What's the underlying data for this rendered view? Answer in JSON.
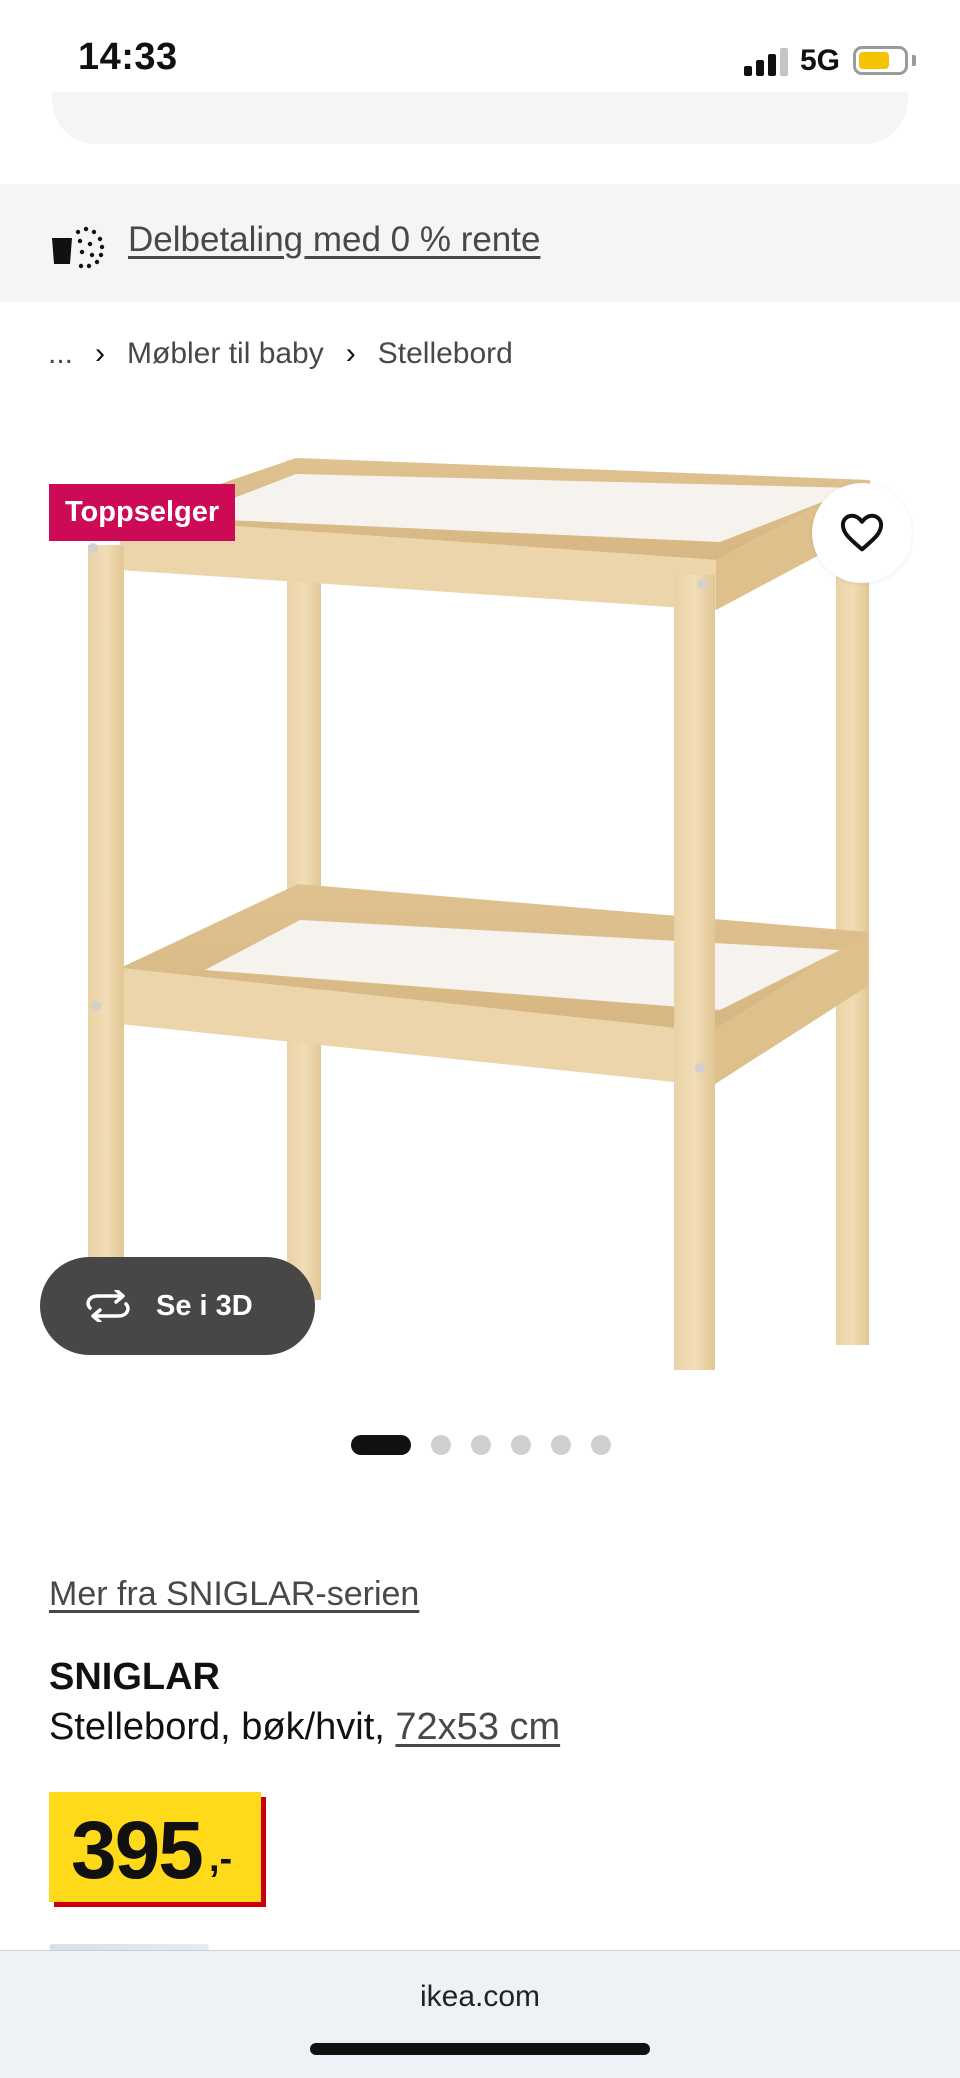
{
  "status_bar": {
    "time": "14:33",
    "network": "5G",
    "battery_level": 0.7,
    "battery_color": "#f5c400"
  },
  "installment_banner": {
    "icon": "installment-payment-icon",
    "link_text": "Delbetaling med 0 % rente"
  },
  "breadcrumb": {
    "items": [
      "...",
      "Møbler til baby",
      "Stellebord"
    ],
    "separator_icon": "chevron-right-icon"
  },
  "gallery": {
    "badge": "Toppselger",
    "badge_color": "#cc0a56",
    "favorite_icon": "heart-outline-icon",
    "view_3d_icon": "rotate-3d-icon",
    "view_3d_label": "Se i 3D",
    "total_images": 6,
    "active_image": 1
  },
  "product": {
    "series_link": "Mer fra SNIGLAR-serien",
    "name": "SNIGLAR",
    "description": "Stellebord, bøk/hvit, ",
    "size": "72x53 cm",
    "price": "395",
    "price_suffix": ",-",
    "price_bg_color": "#ffda1a",
    "price_shadow_color": "#cc0008"
  },
  "browser": {
    "url": "ikea.com"
  }
}
